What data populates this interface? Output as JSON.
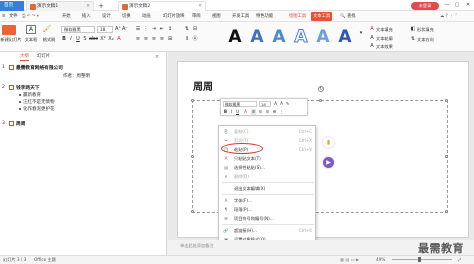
{
  "titlebar": {
    "home_tab": "首页",
    "doc1_tab": "演示文稿1",
    "doc2_tab": "演示文稿2",
    "login_button": "未登录",
    "min": "—",
    "max": "▢",
    "close": "✕",
    "colors": {
      "home": "#3b7ddd",
      "login": "#e34b4b"
    }
  },
  "menubar": {
    "file": "文件",
    "items": [
      "开始",
      "插入",
      "设计",
      "切换",
      "动画",
      "幻灯片放映",
      "审阅",
      "视图",
      "开发工具",
      "特色功能",
      "绘图工具",
      "文本工具"
    ],
    "active_tool_tab": "绘图工具",
    "boxed_tab": "文本工具",
    "search": "查找"
  },
  "ribbon": {
    "new_slide": "新建幻灯片",
    "text_box": "文本框",
    "format_brush": "格式刷",
    "font_name": "微软雅黑",
    "font_size": "18",
    "text_fill": "文本填充",
    "text_outline": "文本轮廓",
    "text_effect": "文本效果",
    "shape_fill": "形状填充",
    "text_direction": "文本方向"
  },
  "left_panel": {
    "tab_outline": "大纲",
    "tab_slides": "幻灯片",
    "slide1_title": "最需教育网络有限公司",
    "slide1_author": "作者：周整明",
    "slide2_title": "钱李两天下",
    "slide2_bullets": [
      "赢新教育",
      "汪红不是无情物",
      "化作春泥更护花"
    ],
    "slide3_title": "周周",
    "nums": [
      "1",
      "2",
      "3"
    ]
  },
  "slide": {
    "title": "周周"
  },
  "mini_toolbar": {
    "font": "微软雅黑",
    "size": "18",
    "bold": "B",
    "italic": "I",
    "underline": "U",
    "align": "≡",
    "color": "A"
  },
  "context_menu": {
    "items": [
      {
        "label": "复制(C)",
        "shortcut": "Ctrl+C",
        "disabled": true,
        "icon": "copy-icon",
        "glyph": "⎘"
      },
      {
        "label": "剪切(T)",
        "shortcut": "Ctrl+X",
        "disabled": true,
        "icon": "cut-icon",
        "glyph": "✂"
      },
      {
        "label": "粘贴(P)",
        "shortcut": "Ctrl+V",
        "disabled": false,
        "icon": "paste-icon",
        "glyph": "📋"
      },
      {
        "label": "只粘贴文本(T)",
        "shortcut": "",
        "disabled": false,
        "icon": "paste-text-icon",
        "glyph": "A"
      },
      {
        "label": "选择性粘贴(S)...",
        "shortcut": "",
        "disabled": false,
        "icon": "paste-special-icon",
        "glyph": "▤"
      },
      {
        "label": "删除(D)",
        "shortcut": "",
        "disabled": true,
        "icon": "delete-icon",
        "glyph": "✕"
      },
      {
        "label": "退出文本编辑(X)",
        "shortcut": "",
        "disabled": false,
        "icon": "exit-edit-icon",
        "glyph": ""
      },
      {
        "label": "字体(F)...",
        "shortcut": "",
        "disabled": false,
        "icon": "font-icon",
        "glyph": "A"
      },
      {
        "label": "段落(P)...",
        "shortcut": "",
        "disabled": false,
        "icon": "paragraph-icon",
        "glyph": "¶"
      },
      {
        "label": "项目符号和编号(N)...",
        "shortcut": "",
        "disabled": false,
        "icon": "bullets-icon",
        "glyph": "☰"
      },
      {
        "label": "超链接(H)...",
        "shortcut": "Ctrl+K",
        "disabled": false,
        "icon": "link-icon",
        "glyph": "🔗"
      },
      {
        "label": "设置对象格式(O)...",
        "shortcut": "",
        "disabled": false,
        "icon": "format-object-icon",
        "glyph": "▣"
      },
      {
        "label": "自定义动画(M)...",
        "shortcut": "",
        "disabled": false,
        "icon": "animation-icon",
        "glyph": "★"
      },
      {
        "label": "动作设置(A)...",
        "shortcut": "",
        "disabled": false,
        "icon": "action-icon",
        "glyph": "➤"
      },
      {
        "label": "设置对象格式(O)...",
        "shortcut": "",
        "disabled": false,
        "icon": "format-object-2-icon",
        "glyph": "◧"
      }
    ]
  },
  "notes": {
    "placeholder": "单击此处添加备注"
  },
  "status": {
    "page": "幻灯片 3 / 3",
    "theme": "Office 主题",
    "zoom": "49%"
  },
  "watermark": "最需教育"
}
